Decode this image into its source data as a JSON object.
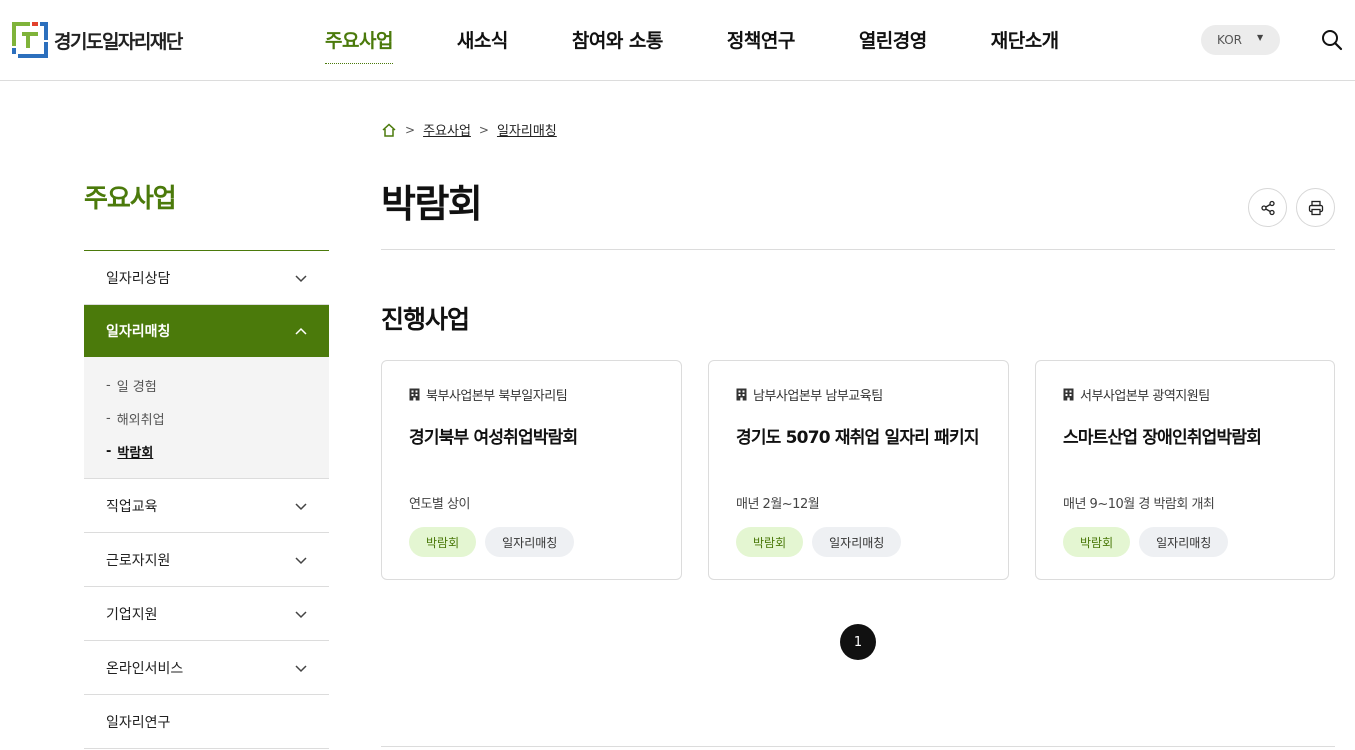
{
  "header": {
    "logo_text": "경기도일자리재단",
    "nav": [
      "주요사업",
      "새소식",
      "참여와 소통",
      "정책연구",
      "열린경영",
      "재단소개"
    ],
    "active_nav_index": 0,
    "lang": "KOR",
    "search_icon": "search-icon"
  },
  "sidebar": {
    "title": "주요사업",
    "items": [
      {
        "label": "일자리상담"
      },
      {
        "label": "일자리매칭",
        "open": true
      },
      {
        "label": "직업교육"
      },
      {
        "label": "근로자지원"
      },
      {
        "label": "기업지원"
      },
      {
        "label": "온라인서비스"
      },
      {
        "label": "일자리연구"
      }
    ],
    "submenu": [
      {
        "label": "일 경험"
      },
      {
        "label": "해외취업"
      },
      {
        "label": "박람회",
        "current": true
      }
    ],
    "dash": "-"
  },
  "breadcrumb": {
    "home_icon": "home-icon",
    "items": [
      "주요사업",
      "일자리매칭"
    ]
  },
  "page": {
    "title": "박람회",
    "section_title": "진행사업",
    "share_icon": "share-icon",
    "print_icon": "print-icon"
  },
  "cards": [
    {
      "org": "북부사업본부 북부일자리팀",
      "title": "경기북부 여성취업박람회",
      "period": "연도별 상이",
      "tags": [
        "박람회",
        "일자리매칭"
      ]
    },
    {
      "org": "남부사업본부 남부교육팀",
      "title": "경기도 5070 재취업 일자리 패키지",
      "period": "매년 2월~12월",
      "tags": [
        "박람회",
        "일자리매칭"
      ]
    },
    {
      "org": "서부사업본부 광역지원팀",
      "title": "스마트산업 장애인취업박람회",
      "period": "매년 9~10월 경 박람회 개최",
      "tags": [
        "박람회",
        "일자리매칭"
      ]
    }
  ],
  "pagination": {
    "current": "1"
  },
  "colors": {
    "brand_green": "#4b7a0b",
    "tag_green_bg": "#e4f6d2",
    "tag_gray_bg": "#eef0f3"
  }
}
